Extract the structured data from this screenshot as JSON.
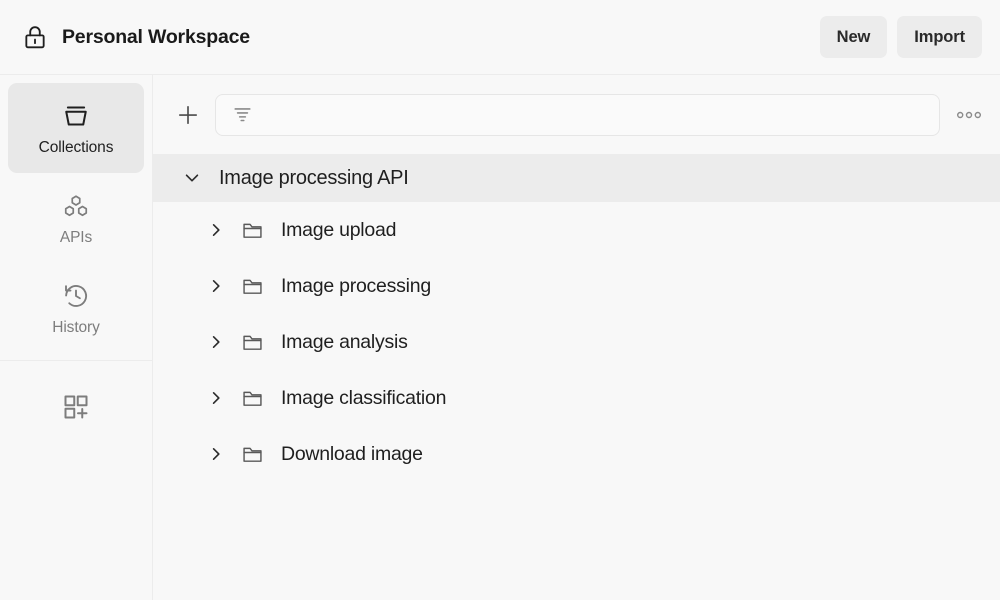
{
  "header": {
    "lock_icon": "lock-icon",
    "title": "Personal Workspace",
    "buttons": [
      {
        "label": "New",
        "name": "new-button"
      },
      {
        "label": "Import",
        "name": "import-button"
      }
    ]
  },
  "sidebar": {
    "items": [
      {
        "label": "Collections",
        "icon": "collections-icon",
        "active": true
      },
      {
        "label": "APIs",
        "icon": "apis-icon",
        "active": false
      },
      {
        "label": "History",
        "icon": "history-icon",
        "active": false
      }
    ],
    "extra_icon": "add-module-icon"
  },
  "toolbar": {
    "add_icon": "plus-icon",
    "filter_icon": "filter-icon",
    "search_value": "",
    "search_placeholder": "",
    "more_icon": "ellipsis-icon"
  },
  "tree": {
    "collection": {
      "name": "Image processing API",
      "expanded": true,
      "chevron_icon": "chevron-down-icon"
    },
    "folders": [
      {
        "name": "Image upload",
        "chevron_icon": "chevron-right-icon",
        "icon": "folder-icon"
      },
      {
        "name": "Image processing",
        "chevron_icon": "chevron-right-icon",
        "icon": "folder-icon"
      },
      {
        "name": "Image analysis",
        "chevron_icon": "chevron-right-icon",
        "icon": "folder-icon"
      },
      {
        "name": "Image classification",
        "chevron_icon": "chevron-right-icon",
        "icon": "folder-icon"
      },
      {
        "name": "Download image",
        "chevron_icon": "chevron-right-icon",
        "icon": "folder-icon"
      }
    ]
  },
  "colors": {
    "header_bg": "#f8f8f8",
    "panel_bg": "#f8f8f8",
    "active_nav_bg": "#e8e8e8",
    "collection_row_bg": "#ececec",
    "button_bg": "#ececec",
    "border": "#ececec",
    "text": "#1f1f1f",
    "muted_text": "#7d7d7d"
  }
}
